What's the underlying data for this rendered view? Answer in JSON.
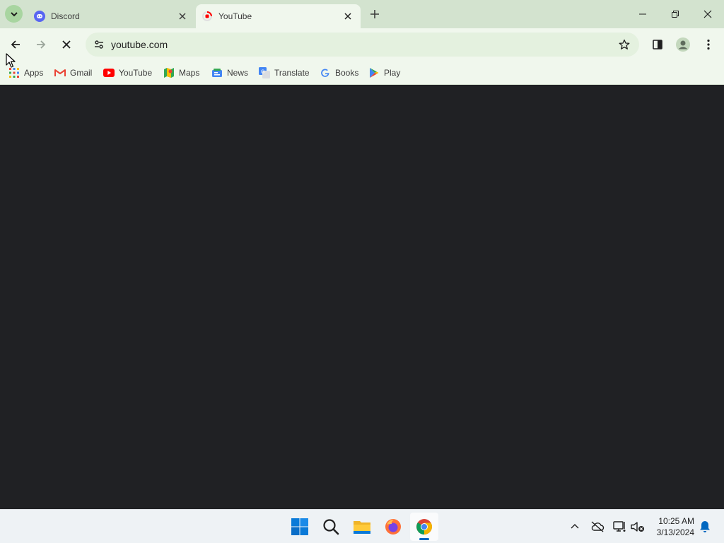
{
  "tabs": [
    {
      "title": "Discord",
      "favicon": "discord-icon",
      "active": false
    },
    {
      "title": "YouTube",
      "favicon": "youtube-icon",
      "active": true
    }
  ],
  "toolbar": {
    "url": "youtube.com",
    "loading": true
  },
  "bookmarks": [
    {
      "label": "Apps",
      "icon": "apps-grid-icon"
    },
    {
      "label": "Gmail",
      "icon": "gmail-icon"
    },
    {
      "label": "YouTube",
      "icon": "youtube-icon"
    },
    {
      "label": "Maps",
      "icon": "maps-icon"
    },
    {
      "label": "News",
      "icon": "news-icon"
    },
    {
      "label": "Translate",
      "icon": "translate-icon"
    },
    {
      "label": "Books",
      "icon": "google-icon"
    },
    {
      "label": "Play",
      "icon": "play-store-icon"
    }
  ],
  "taskbar": {
    "apps": [
      "start-icon",
      "search-icon",
      "file-explorer-icon",
      "firefox-icon",
      "chrome-icon"
    ],
    "active_app": "chrome-icon",
    "clock": {
      "time": "10:25 AM",
      "date": "3/13/2024"
    }
  },
  "colors": {
    "tabstrip": "#d3e3cf",
    "toolbar": "#f0f7ed",
    "content": "#202124",
    "taskbar": "#eef2f5"
  }
}
